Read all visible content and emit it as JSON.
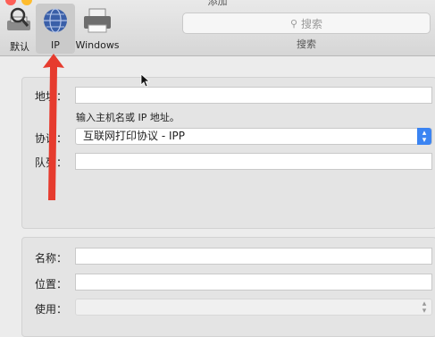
{
  "window": {
    "title": "添加"
  },
  "toolbar": {
    "buttons": [
      {
        "label": "默认",
        "icon": "default-printer-icon"
      },
      {
        "label": "IP",
        "icon": "globe-icon",
        "selected": true
      },
      {
        "label": "Windows",
        "icon": "windows-printer-icon"
      }
    ],
    "search_placeholder": "搜索",
    "search_label": "搜索"
  },
  "form": {
    "address_label": "地址：",
    "address_value": "",
    "address_hint": "输入主机名或 IP 地址。",
    "protocol_label": "协议：",
    "protocol_value": "互联网打印协议 - IPP",
    "queue_label": "队列：",
    "queue_value": "",
    "name_label": "名称：",
    "name_value": "",
    "location_label": "位置：",
    "location_value": "",
    "use_label": "使用：",
    "use_value": ""
  },
  "colors": {
    "accent": "#3b84f2",
    "annotation": "#e63b2e"
  }
}
